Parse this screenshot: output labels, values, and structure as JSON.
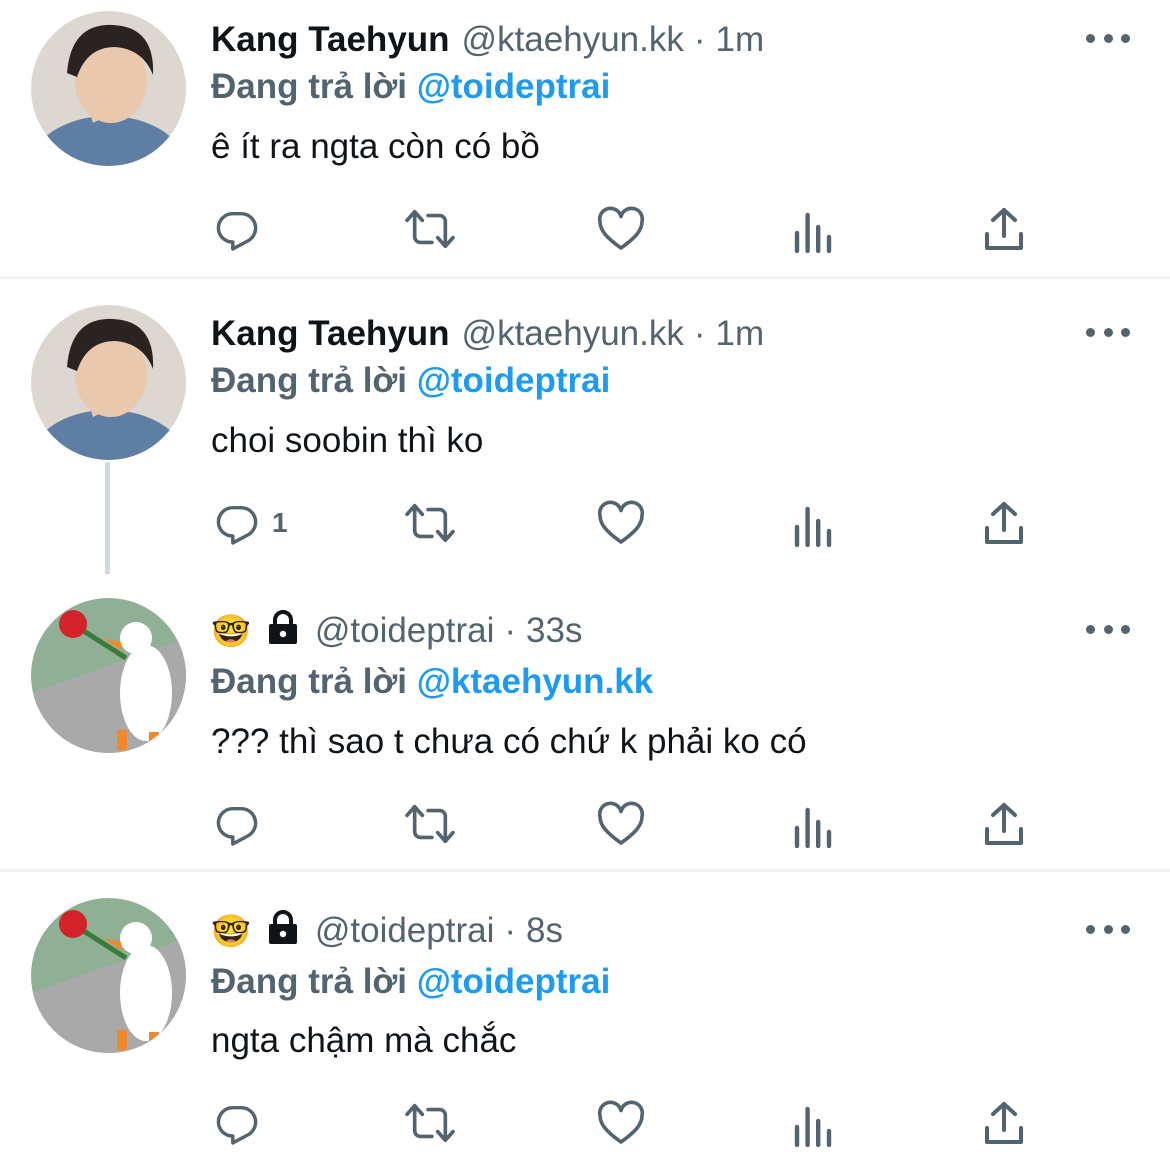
{
  "tweets": [
    {
      "display_name": "Kang Taehyun",
      "handle": "@ktaehyun.kk",
      "dot": "·",
      "time": "1m",
      "reply_label": "Đang trả lời",
      "reply_to": "@toideptrai",
      "text": "ê ít ra ngta còn có bồ",
      "reply_count": ""
    },
    {
      "display_name": "Kang Taehyun",
      "handle": "@ktaehyun.kk",
      "dot": "·",
      "time": "1m",
      "reply_label": "Đang trả lời",
      "reply_to": "@toideptrai",
      "text": "choi soobin thì ko",
      "reply_count": "1"
    },
    {
      "display_name": "",
      "emoji": "🤓",
      "handle": "@toideptrai",
      "dot": "·",
      "time": "33s",
      "reply_label": "Đang trả lời",
      "reply_to": "@ktaehyun.kk",
      "text": "??? thì sao t chưa có chứ k phải ko có",
      "reply_count": ""
    },
    {
      "display_name": "",
      "emoji": "🤓",
      "handle": "@toideptrai",
      "dot": "·",
      "time": "8s",
      "reply_label": "Đang trả lời",
      "reply_to": "@toideptrai",
      "text": "ngta chậm mà chắc",
      "reply_count": ""
    }
  ],
  "icons": {
    "reply": "reply-icon",
    "retweet": "retweet-icon",
    "like": "heart-icon",
    "views": "views-icon",
    "share": "share-icon",
    "more": "more-icon",
    "lock": "lock-icon"
  },
  "colors": {
    "mention": "#1d9bf0",
    "secondary_text": "#536471",
    "divider": "#eff3f4"
  }
}
